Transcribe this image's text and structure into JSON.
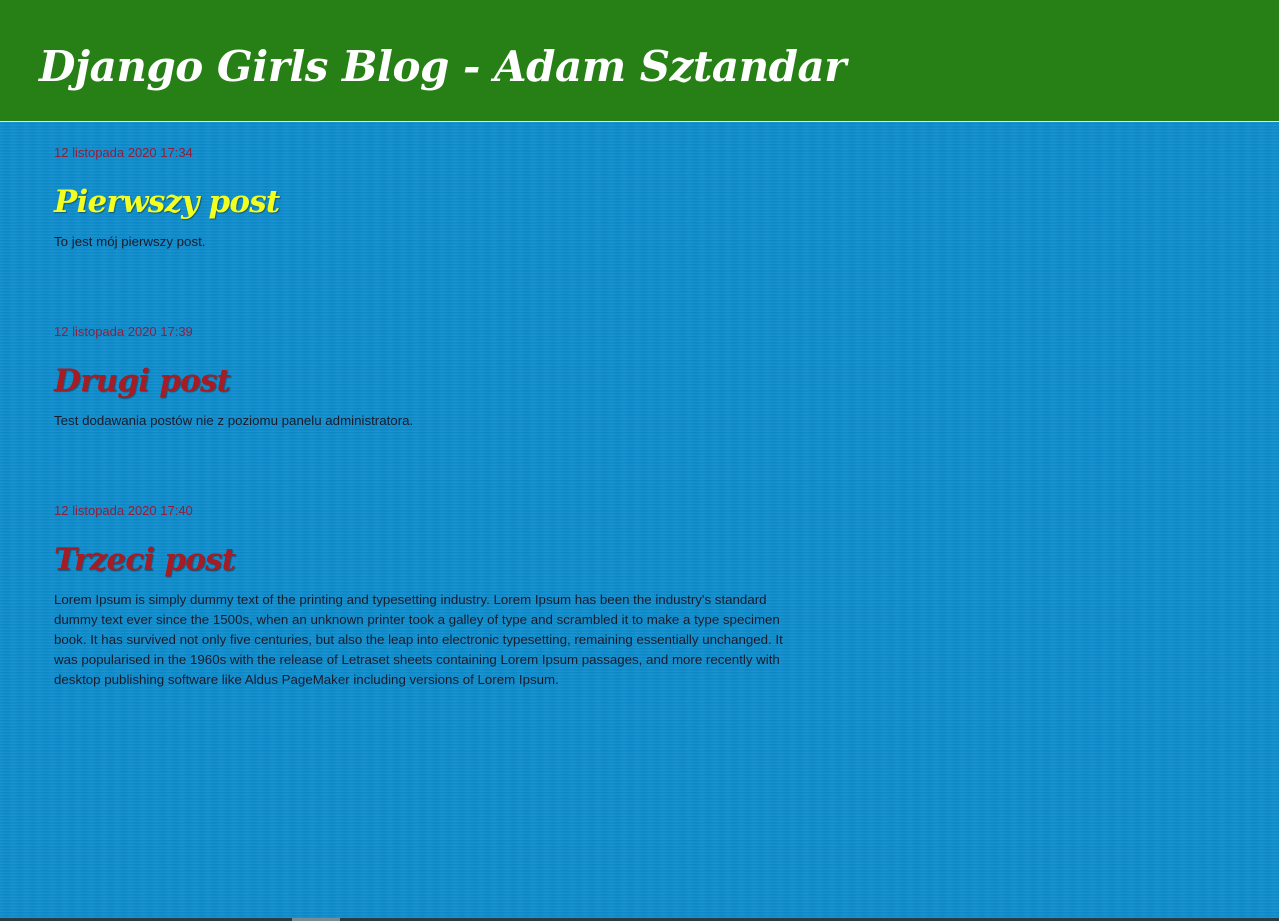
{
  "header": {
    "title": "Django Girls Blog - Adam Sztandar"
  },
  "colors": {
    "header_background": "#268015",
    "page_background": "#0b8ccd",
    "first_title": "#f2ff1f",
    "other_titles": "#a51c24",
    "date": "#8f1f3c"
  },
  "posts": [
    {
      "date": "12 listopada 2020 17:34",
      "title": "Pierwszy post",
      "text": "To jest mój pierwszy post."
    },
    {
      "date": "12 listopada 2020 17:39",
      "title": "Drugi post",
      "text": "Test dodawania postów nie z poziomu panelu administratora."
    },
    {
      "date": "12 listopada 2020 17:40",
      "title": "Trzeci post",
      "text": "Lorem Ipsum is simply dummy text of the printing and typesetting industry. Lorem Ipsum has been the industry's standard dummy text ever since the 1500s, when an unknown printer took a galley of type and scrambled it to make a type specimen book. It has survived not only five centuries, but also the leap into electronic typesetting, remaining essentially unchanged. It was popularised in the 1960s with the release of Letraset sheets containing Lorem Ipsum passages, and more recently with desktop publishing software like Aldus PageMaker including versions of Lorem Ipsum."
    }
  ]
}
